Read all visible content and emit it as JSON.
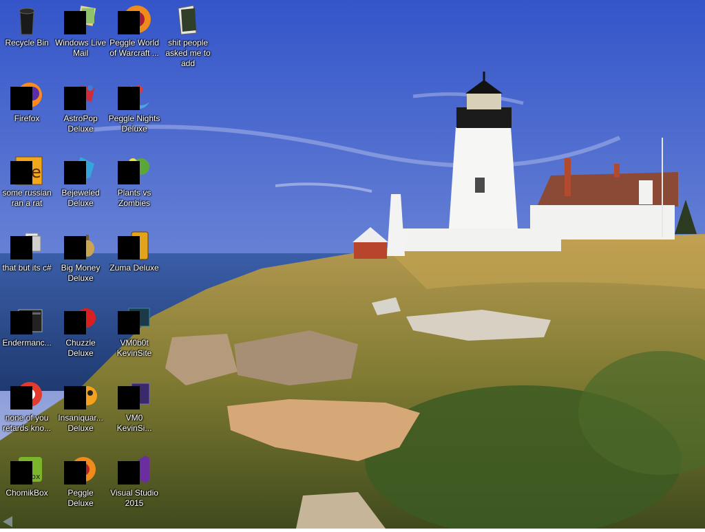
{
  "desktop": {
    "icons": [
      {
        "label": "Recycle Bin",
        "icon": "recycle-bin-icon"
      },
      {
        "label": "Windows Live Mail",
        "icon": "windows-live-mail-icon"
      },
      {
        "label": "Peggle World of Warcraft ...",
        "icon": "peggle-wow-icon"
      },
      {
        "label": "shit people asked me to add",
        "icon": "folder-icon"
      },
      {
        "label": "Firefox",
        "icon": "firefox-icon"
      },
      {
        "label": "AstroPop Deluxe",
        "icon": "astropop-icon"
      },
      {
        "label": "Peggle Nights Deluxe",
        "icon": "peggle-nights-icon"
      },
      {
        "label": "some russian ran a rat",
        "icon": "application-icon"
      },
      {
        "label": "Bejeweled Deluxe",
        "icon": "bejeweled-icon"
      },
      {
        "label": "Plants vs Zombies",
        "icon": "plants-vs-zombies-icon"
      },
      {
        "label": "that but its c#",
        "icon": "shortcut-icon"
      },
      {
        "label": "Big Money Deluxe",
        "icon": "big-money-icon"
      },
      {
        "label": "Zuma Deluxe",
        "icon": "zuma-icon"
      },
      {
        "label": "Endermanc...",
        "icon": "terminal-icon"
      },
      {
        "label": "Chuzzle Deluxe",
        "icon": "chuzzle-icon"
      },
      {
        "label": "VM0b0t KevinSite",
        "icon": "vm-icon"
      },
      {
        "label": "none of you retards kno...",
        "icon": "chrome-icon"
      },
      {
        "label": "Insaniquar... Deluxe",
        "icon": "insaniquarium-icon"
      },
      {
        "label": "VM0 KevinSi...",
        "icon": "vm-icon"
      },
      {
        "label": "ChomikBox",
        "icon": "chomikbox-icon"
      },
      {
        "label": "Peggle Deluxe",
        "icon": "peggle-icon"
      },
      {
        "label": "Visual Studio 2015",
        "icon": "visual-studio-icon"
      }
    ]
  },
  "colors": {
    "sky_top": "#3a5fd0",
    "sky_bottom": "#9fb4e8",
    "sea": "#2c4f8f",
    "grass": "#8a8a3a",
    "rock": "#d8b48a"
  }
}
